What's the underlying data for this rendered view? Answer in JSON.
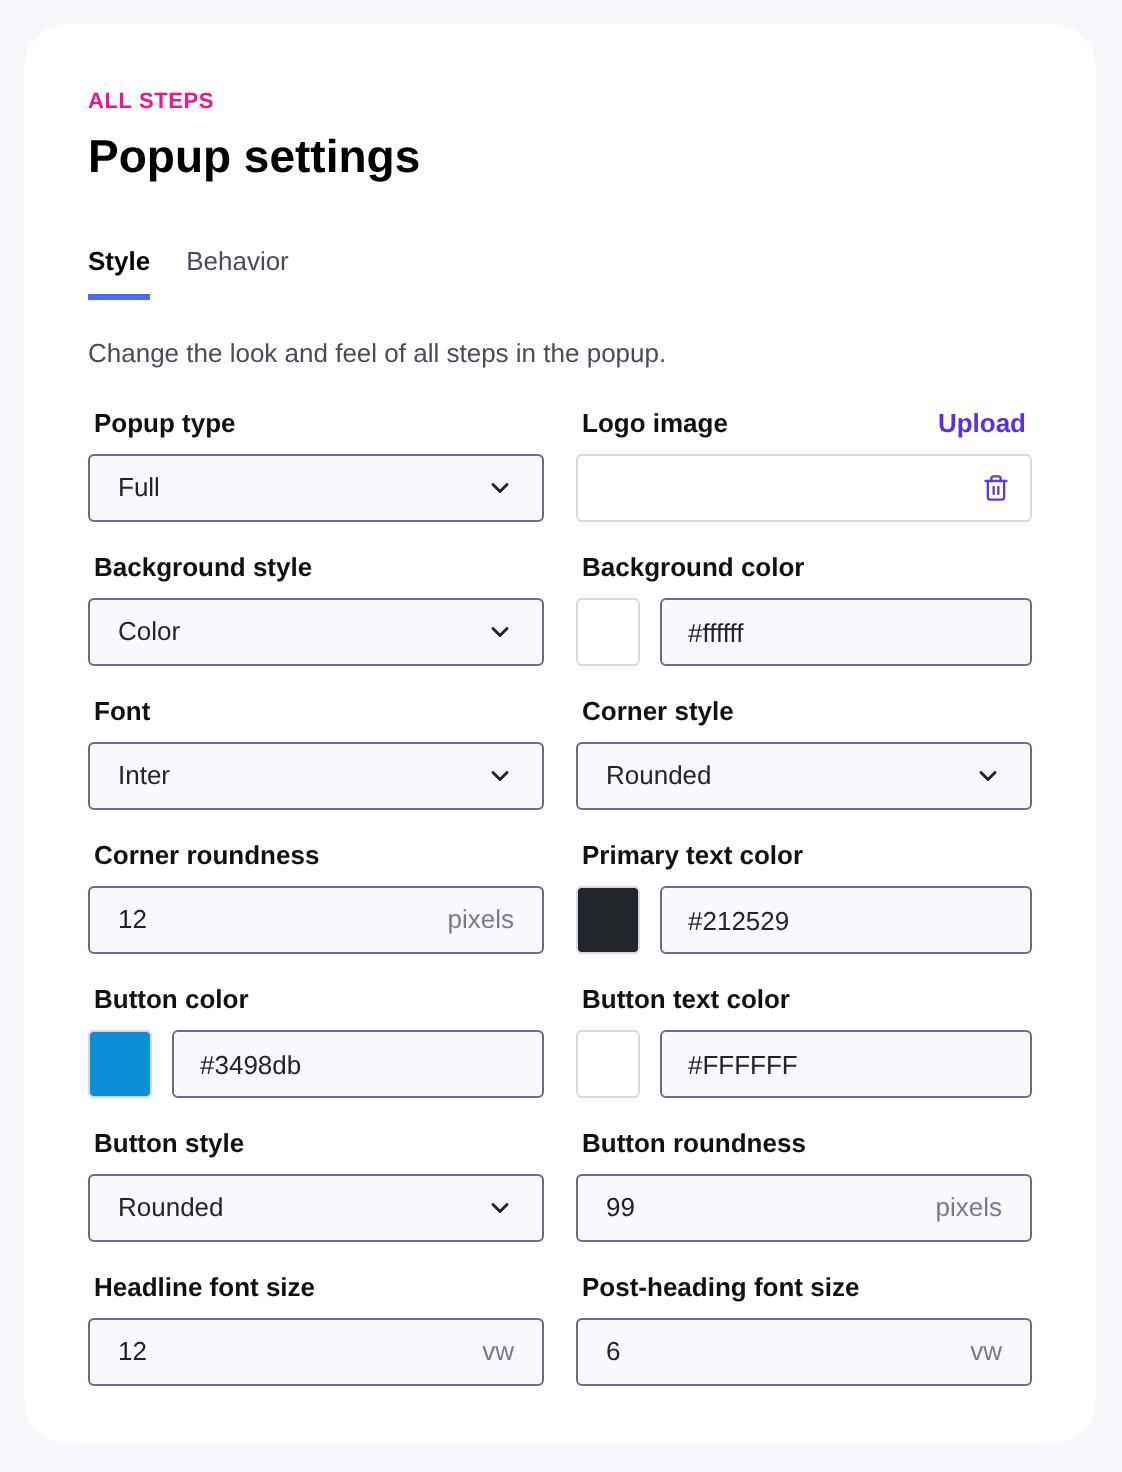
{
  "eyebrow": "ALL STEPS",
  "title": "Popup settings",
  "tabs": [
    {
      "label": "Style",
      "selected": true
    },
    {
      "label": "Behavior",
      "selected": false
    }
  ],
  "description": "Change the look and feel of all steps in the popup.",
  "fields": [
    {
      "kind": "select",
      "label": "Popup type",
      "value": "Full"
    },
    {
      "kind": "logo",
      "label": "Logo image",
      "action": "Upload"
    },
    {
      "kind": "select",
      "label": "Background style",
      "value": "Color"
    },
    {
      "kind": "color",
      "label": "Background color",
      "value": "#ffffff",
      "color": "#ffffff"
    },
    {
      "kind": "select",
      "label": "Font",
      "value": "Inter"
    },
    {
      "kind": "select",
      "label": "Corner style",
      "value": "Rounded"
    },
    {
      "kind": "number",
      "label": "Corner roundness",
      "value": "12",
      "unit": "pixels"
    },
    {
      "kind": "color",
      "label": "Primary text color",
      "value": "#212529",
      "color": "#212529"
    },
    {
      "kind": "color",
      "label": "Button color",
      "value": "#3498db",
      "color": "#0b8fd6"
    },
    {
      "kind": "color",
      "label": "Button text color",
      "value": "#FFFFFF",
      "color": "#ffffff"
    },
    {
      "kind": "select",
      "label": "Button style",
      "value": "Rounded"
    },
    {
      "kind": "number",
      "label": "Button roundness",
      "value": "99",
      "unit": "pixels"
    },
    {
      "kind": "number",
      "label": "Headline font size",
      "value": "12",
      "unit": "vw"
    },
    {
      "kind": "number",
      "label": "Post-heading font size",
      "value": "6",
      "unit": "vw"
    }
  ]
}
